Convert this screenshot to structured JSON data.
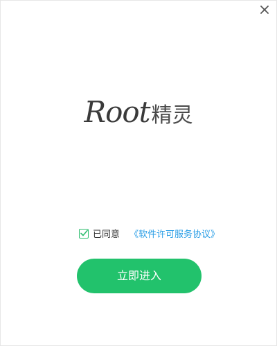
{
  "window": {
    "close_icon": "close-icon"
  },
  "logo": {
    "script_text": "Root",
    "cjk_text": "精灵"
  },
  "agreement": {
    "checked": true,
    "label": "已同意",
    "link_text": "《软件许可服务协议》"
  },
  "enter_button": {
    "label": "立即进入"
  },
  "colors": {
    "accent_green": "#22c26c",
    "link_blue": "#2a9ee6"
  }
}
